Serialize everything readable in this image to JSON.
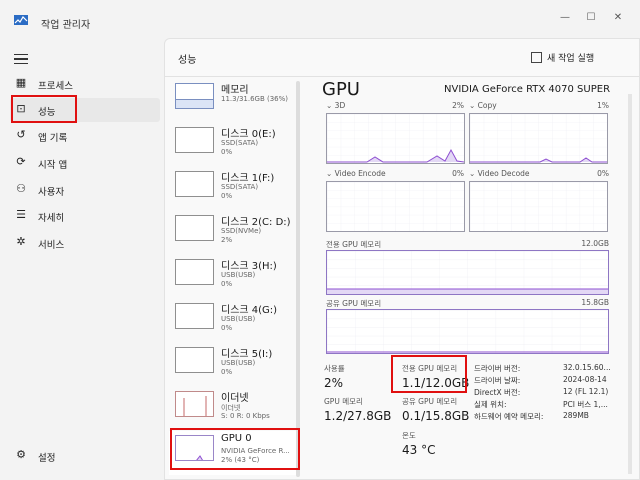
{
  "window": {
    "title": "작업 관리자",
    "minimize": "—",
    "maximize": "☐",
    "close": "✕"
  },
  "sidebar": {
    "items": [
      {
        "label": "프로세스",
        "icon": "▦"
      },
      {
        "label": "성능",
        "icon": "⊡"
      },
      {
        "label": "앱 기록",
        "icon": "↺"
      },
      {
        "label": "시작 앱",
        "icon": "⟳"
      },
      {
        "label": "사용자",
        "icon": "⚇"
      },
      {
        "label": "자세히",
        "icon": "☰"
      },
      {
        "label": "서비스",
        "icon": "✲"
      }
    ],
    "settings": {
      "label": "설정",
      "icon": "⚙"
    }
  },
  "content": {
    "title": "성능",
    "new_task": "새 작업 실행"
  },
  "devices": [
    {
      "name": "메모리",
      "sub1": "11.3/31.6GB (36%)",
      "sub2": ""
    },
    {
      "name": "디스크 0(E:)",
      "sub1": "SSD(SATA)",
      "sub2": "0%"
    },
    {
      "name": "디스크 1(F:)",
      "sub1": "SSD(SATA)",
      "sub2": "0%"
    },
    {
      "name": "디스크 2(C: D:)",
      "sub1": "SSD(NVMe)",
      "sub2": "2%"
    },
    {
      "name": "디스크 3(H:)",
      "sub1": "USB(USB)",
      "sub2": "0%"
    },
    {
      "name": "디스크 4(G:)",
      "sub1": "USB(USB)",
      "sub2": "0%"
    },
    {
      "name": "디스크 5(I:)",
      "sub1": "USB(USB)",
      "sub2": "0%"
    },
    {
      "name": "이더넷",
      "sub1": "이더넷",
      "sub2": "S: 0 R: 0 Kbps"
    },
    {
      "name": "GPU 0",
      "sub1": "NVIDIA GeForce R...",
      "sub2": "2% (43 °C)"
    }
  ],
  "gpu": {
    "title": "GPU",
    "model": "NVIDIA GeForce RTX 4070 SUPER",
    "engines": [
      {
        "label": "3D",
        "pct": "2%"
      },
      {
        "label": "Copy",
        "pct": "1%"
      },
      {
        "label": "Video Encode",
        "pct": "0%"
      },
      {
        "label": "Video Decode",
        "pct": "0%"
      }
    ],
    "dedicated_graph": {
      "label": "전용 GPU 메모리",
      "max": "12.0GB"
    },
    "shared_graph": {
      "label": "공유 GPU 메모리",
      "max": "15.8GB"
    },
    "stats": {
      "usage_label": "사용률",
      "usage": "2%",
      "dedicated_label": "전용 GPU 메모리",
      "dedicated": "1.1/12.0GB",
      "gpu_mem_label": "GPU 메모리",
      "gpu_mem": "1.2/27.8GB",
      "shared_label": "공유 GPU 메모리",
      "shared": "0.1/15.8GB",
      "temp_label": "온도",
      "temp": "43 °C"
    },
    "info": [
      {
        "k": "드라이버 버전:",
        "v": "32.0.15.60..."
      },
      {
        "k": "드라이버 날짜:",
        "v": "2024-08-14"
      },
      {
        "k": "DirectX 버전:",
        "v": "12 (FL 12.1)"
      },
      {
        "k": "실제 위치:",
        "v": "PCI 버스 1,..."
      },
      {
        "k": "하드웨어 예약 메모리:",
        "v": "289MB"
      }
    ]
  },
  "colors": {
    "accent": "#8e4fd1",
    "highlight": "#e01010"
  }
}
